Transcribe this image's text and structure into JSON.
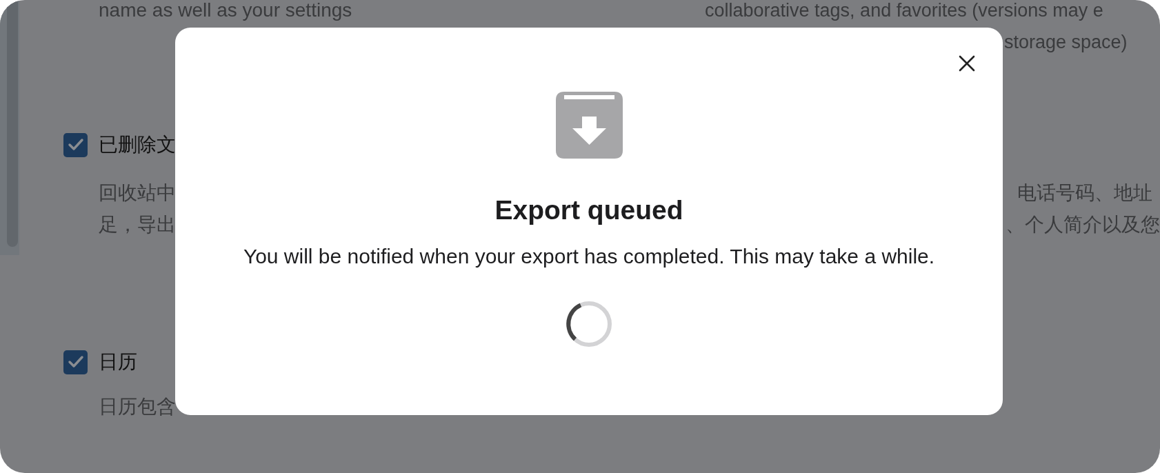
{
  "background": {
    "left": {
      "intro_line": "name as well as your settings",
      "options": [
        {
          "label": "已删除文",
          "checked": true,
          "description_lines": [
            "回收站中",
            "足，导出"
          ]
        },
        {
          "label": "日历",
          "checked": true,
          "description_lines": [
            "日历包含"
          ]
        }
      ]
    },
    "right": {
      "intro_lines": [
        "collaborative tags, and favorites (versions may e",
        "storage space)"
      ],
      "description_lines": [
        "电话号码、地址",
        "、个人简介以及您"
      ]
    }
  },
  "modal": {
    "title": "Export queued",
    "message": "You will be notified when your export has completed. This may take a while."
  }
}
